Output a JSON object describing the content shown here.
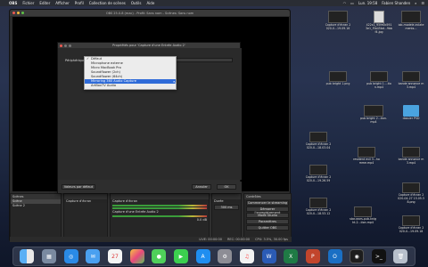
{
  "menubar": {
    "app_name": "OBS",
    "items": [
      "Fichier",
      "Editer",
      "Afficher",
      "Profil",
      "Collection de scènes",
      "Outils",
      "Aide"
    ],
    "clock": "Lun. 19:58",
    "user": "Fabien Shanden"
  },
  "obs": {
    "title": "OBS 25.0.8 (mac) - Profil: Sans nom - Scènes: Sans nom",
    "scenes_header": "Scènes",
    "scene_rows": [
      "Scène",
      "Scène 2"
    ],
    "audio_source": "Capture d'écran",
    "mixer_label": "Capture d'une Entrée Audio 2",
    "mixer_value": "0.0 dB",
    "transition_duration_label": "Durée",
    "transition_duration_value": "300 ms",
    "controls": [
      "Commencer le streaming",
      "Démarrer l'enregistrement",
      "Mode Studio",
      "Paramètres",
      "Quitter OBS"
    ],
    "controls_header": "Contrôles",
    "status": {
      "live": "LIVE: 00:00:00",
      "rec": "REC: 00:00:00",
      "cpu": "CPU: 3.5%, 30.00 fps"
    }
  },
  "dialog": {
    "title": "Propriétés pour 'Capture d'une Entrée Audio 2'",
    "device_label": "Périphérique",
    "device_value": "Défaut",
    "options": [
      "Défaut",
      "Microphone externe",
      "Micro MacBook Pro",
      "Soundflower (2ch)",
      "Soundflower (64ch)",
      "Mirroring 360 Audio Capture",
      "ArtBoxTV Audio"
    ],
    "selected_option": "Mirroring 360 Audio Capture",
    "reset_label": "Valeurs par défaut",
    "cancel_label": "Annuler",
    "ok_label": "OK"
  },
  "desktop": {
    "icons": [
      "Capture d'écran 2020-0...19.09.16",
      "422x1_95fe0b5913e1_f5b45bd...9bbf4.jpg",
      "iob-modele-eclatements...",
      "pub bright 1.png",
      "pub bright 1....tion.mp4",
      "pub bright 2...tion.mp4",
      "bande annonce m3.mp4",
      "dossier PSD",
      "Capture d'écran 2020-0...18.03.04",
      "resident evil 3...homme.mp4",
      "Capture d'écran 2020-0...19.26.59",
      "bande annonce m3.mp4",
      "Capture d'écran 2020-0...18.53.12",
      "Capture d'écran 2020-04-27 15.05.38.png",
      "star-wars-pub-knight-2...tion.mp4",
      "Capture d'écran 2020-0...19.09.18"
    ]
  },
  "dock_apps": [
    "Finder",
    "Launchpad",
    "Safari",
    "Mail",
    "Calendrier",
    "Photos",
    "Messages",
    "FaceTime",
    "App Store",
    "Préférences",
    "Musique",
    "Word",
    "Excel",
    "PowerPoint",
    "Outlook",
    "OBS",
    "Terminal",
    "Corbeille"
  ]
}
